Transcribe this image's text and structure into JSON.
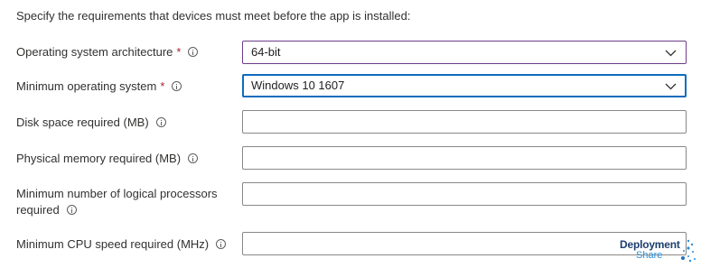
{
  "intro_text": "Specify the requirements that devices must meet before the app is installed:",
  "required_marker": "*",
  "fields": {
    "os_architecture": {
      "label": "Operating system architecture",
      "value": "64-bit",
      "required": true
    },
    "min_os": {
      "label": "Minimum operating system",
      "value": "Windows 10 1607",
      "required": true
    },
    "disk_space": {
      "label": "Disk space required (MB)",
      "value": ""
    },
    "physical_memory": {
      "label": "Physical memory required (MB)",
      "value": ""
    },
    "logical_processors": {
      "label_line1": "Minimum number of logical processors",
      "label_line2": "required",
      "value": ""
    },
    "cpu_speed": {
      "label": "Minimum CPU speed required (MHz)",
      "value": ""
    }
  },
  "icons": {
    "info": "info-icon",
    "dropdown": "chevron-down-icon"
  },
  "colors": {
    "required": "#a4262c",
    "active_border": "#6f3c8b",
    "focus_border": "#0f6cbd",
    "field_border": "#8a8886"
  },
  "watermark": {
    "title": "Deployment",
    "subtitle": "Share"
  }
}
